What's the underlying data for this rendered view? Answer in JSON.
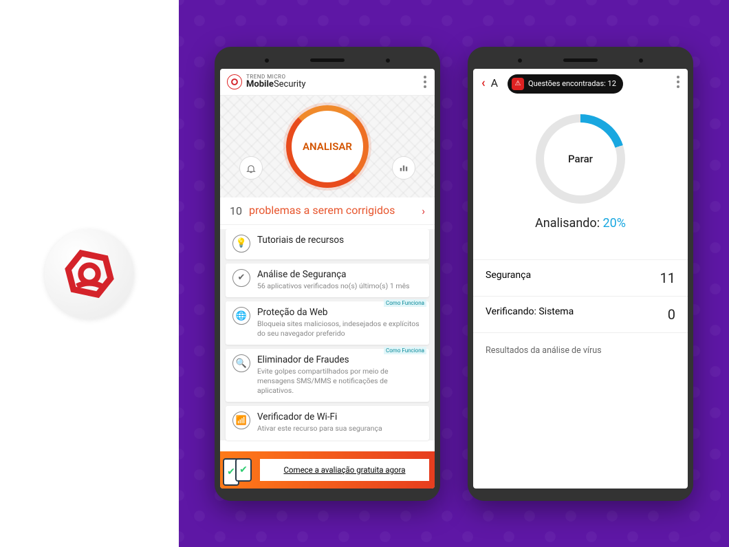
{
  "brand": {
    "company": "TREND MICRO",
    "product_bold": "Mobile",
    "product_light": "Security"
  },
  "phone1": {
    "scan_button": "ANALISAR",
    "problems": {
      "count": "10",
      "label": "problemas a serem corrigidos"
    },
    "cards": [
      {
        "icon": "lightbulb",
        "title": "Tutoriais de recursos",
        "desc": ""
      },
      {
        "icon": "checkshield",
        "title": "Análise de Segurança",
        "desc": "56 aplicativos verificados no(s) último(s) 1 mês"
      },
      {
        "icon": "globe",
        "title": "Proteção da Web",
        "desc": "Bloqueia sites maliciosos, indesejados e explícitos do seu navegador preferido",
        "tag": "Como Funciona"
      },
      {
        "icon": "magnifier",
        "title": "Eliminador de Fraudes",
        "desc": "Evite golpes compartilhados por meio de mensagens SMS/MMS e notificações de aplicativos.",
        "tag": "Como Funciona"
      },
      {
        "icon": "wifi",
        "title": "Verificador de Wi-Fi",
        "desc": "Ativar este recurso para sua segurança"
      }
    ],
    "cta": "Comece a avaliação gratuita agora"
  },
  "phone2": {
    "toast_prefix": "Questões encontradas:",
    "toast_count": "12",
    "stop_button": "Parar",
    "status_label": "Analisando:",
    "status_percent": "20%",
    "rows": [
      {
        "label": "Segurança",
        "value": "11"
      },
      {
        "label": "Verificando: Sistema",
        "value": "0"
      }
    ],
    "results_label": "Resultados da análise de vírus"
  }
}
